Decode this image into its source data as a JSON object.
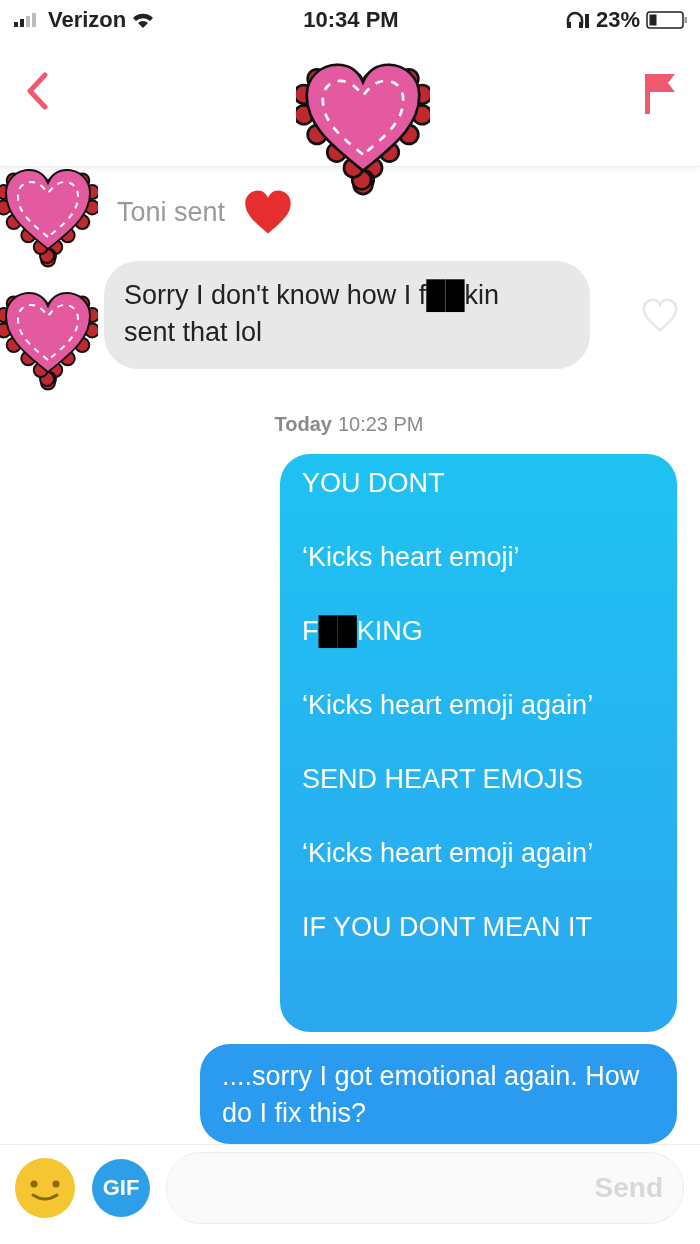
{
  "status_bar": {
    "carrier": "Verizon",
    "time": "10:34 PM",
    "battery": "23%"
  },
  "messages": [
    {
      "kind": "reaction",
      "text": "Toni sent"
    },
    {
      "kind": "received",
      "text": "Sorry I don't know how I f██kin sent that lol",
      "liked": false
    },
    {
      "kind": "timestamp",
      "day": "Today",
      "time": "10:23 PM"
    },
    {
      "kind": "sent",
      "lines": [
        "YOU DONT",
        "‘Kicks heart emoji’",
        "F██KING",
        "‘Kicks heart emoji again’",
        "SEND HEART EMOJIS",
        "‘Kicks heart emoji again’",
        "IF YOU DONT MEAN IT"
      ]
    },
    {
      "kind": "sent",
      "lines": [
        "....sorry I got emotional again. How do I fix this?"
      ]
    }
  ],
  "composer": {
    "gif": "GIF",
    "send": "Send",
    "send_disabled": true
  },
  "stickers": [
    {
      "kind": "heart"
    },
    {
      "kind": "heart"
    },
    {
      "kind": "heart"
    }
  ]
}
